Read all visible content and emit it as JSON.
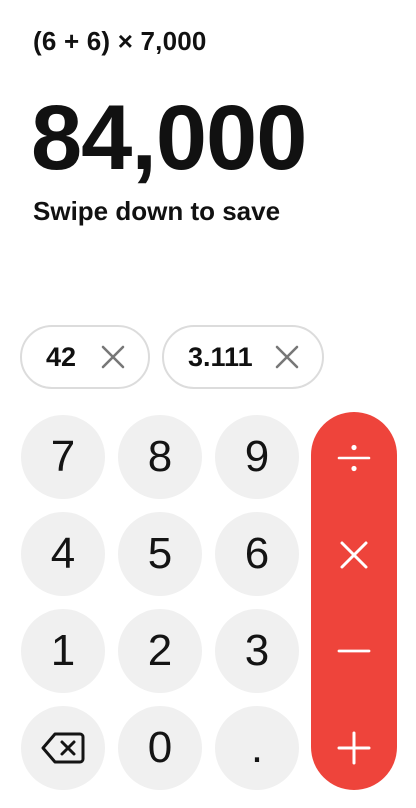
{
  "display": {
    "expression": "(6 + 6) × 7,000",
    "result": "84,000",
    "hint": "Swipe down to save"
  },
  "saved_values": [
    {
      "value": "42"
    },
    {
      "value": "3.111"
    }
  ],
  "keypad": {
    "digits": [
      "7",
      "8",
      "9",
      "4",
      "5",
      "6",
      "1",
      "2",
      "3"
    ],
    "zero": "0",
    "decimal": "."
  },
  "operators": [
    "divide",
    "multiply",
    "subtract",
    "add"
  ],
  "colors": {
    "accent": "#ee443b",
    "key_background": "#f0f0f0",
    "chip_border": "#dcdcdc"
  }
}
